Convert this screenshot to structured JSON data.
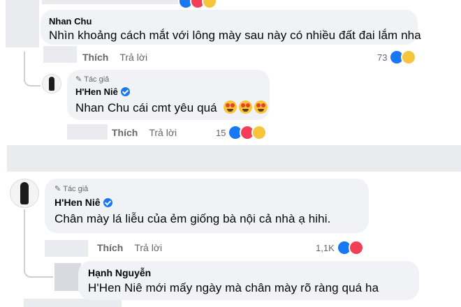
{
  "comment_nhan": {
    "name": "Nhan Chu",
    "text": "Nhìn khoảng cách mắt với lông mày sau này có nhiều đất đai lắm nha",
    "like_label": "Thích",
    "reply_label": "Trả lời",
    "reaction_count": "73",
    "reactions": [
      "like",
      "haha"
    ]
  },
  "reply_hhen_1": {
    "author_tag": "Tác giả",
    "name": "H'Hen Niê",
    "text": "Nhan Chu cái cmt yêu quá",
    "emoji": [
      "star-struck",
      "star-struck",
      "star-struck"
    ],
    "like_label": "Thích",
    "reply_label": "Trả lời",
    "reaction_count": "15",
    "reactions": [
      "like",
      "love",
      "care"
    ]
  },
  "comment_hhen_2": {
    "author_tag": "Tác giả",
    "name": "H'Hen Niê",
    "text": "Chân mày lá liễu của ẻm giống bà nội cả nhà ạ hihi.",
    "like_label": "Thích",
    "reply_label": "Trả lời",
    "reaction_count": "1,1K",
    "reactions": [
      "like",
      "love"
    ]
  },
  "reply_hanh": {
    "name": "Hạnh Nguyễn",
    "text": "H'Hen Niê mới mấy ngày mà chân mày rõ ràng quá ha"
  },
  "colors": {
    "bubble": "#f0f2f5",
    "like_blue": "#1877f2",
    "love_red": "#f33e58",
    "haha_yellow": "#f7c53b",
    "muted_text": "#65676b"
  }
}
